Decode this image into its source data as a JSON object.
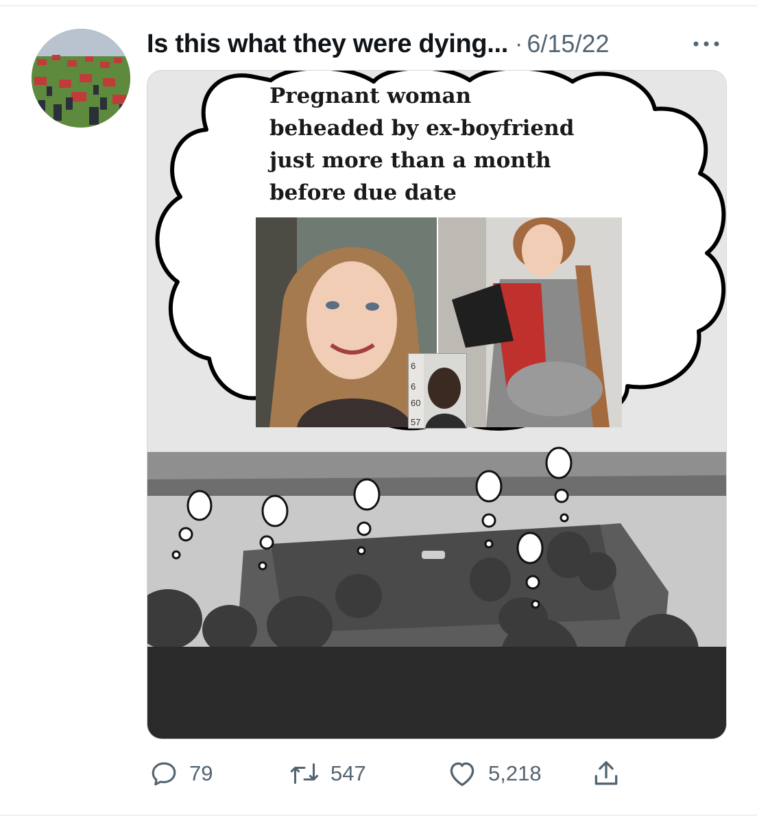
{
  "tweet": {
    "display_name": "Is this what they were dying...",
    "separator": "·",
    "date": "6/15/22"
  },
  "media": {
    "headline": "Pregnant woman beheaded by ex-boyfriend just more than a month before due date",
    "mugshot_scale": [
      "6",
      "6",
      "60",
      "57"
    ]
  },
  "actions": {
    "reply_count": "79",
    "retweet_count": "547",
    "like_count": "5,218"
  },
  "icons": {
    "reply": "reply-icon",
    "retweet": "retweet-icon",
    "like": "heart-icon",
    "share": "share-icon",
    "more": "more-icon"
  },
  "colors": {
    "text_primary": "#0f1419",
    "text_secondary": "#536471",
    "border": "#cfd9de"
  }
}
